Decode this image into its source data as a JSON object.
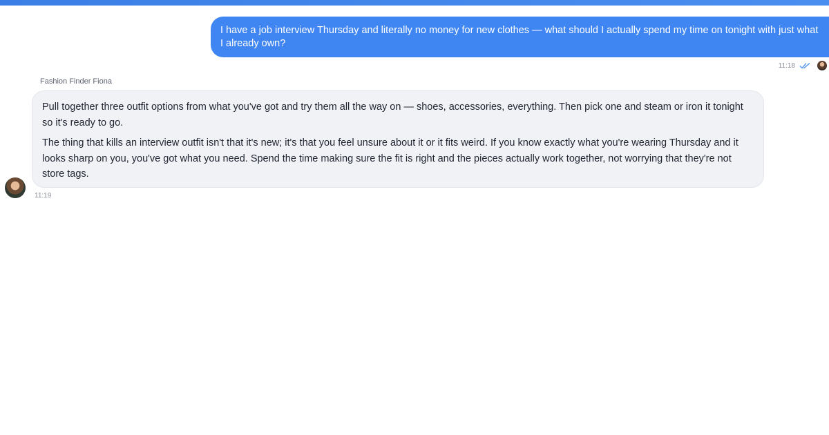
{
  "conversation": {
    "user_message": {
      "text": "I have a job interview Thursday and literally no money for new clothes — what should I actually spend my time on tonight with just what I already own?",
      "time": "11:18",
      "status_icon": "double-check-icon"
    },
    "assistant_message": {
      "sender": "Fashion Finder Fiona",
      "paragraphs": [
        "Pull together three outfit options from what you've got and try them all the way on — shoes, accessories, everything. Then pick one and steam or iron it tonight so it's ready to go.",
        "The thing that kills an interview outfit isn't that it's new; it's that you feel unsure about it or it fits weird. If you know exactly what you're wearing Thursday and it looks sharp on you, you've got what you need. Spend the time making sure the fit is right and the pieces actually work together, not worrying that they're not store tags."
      ],
      "time": "11:19"
    }
  },
  "colors": {
    "accent": "#3f86f2",
    "assistant_bubble": "#f0f2f6"
  }
}
